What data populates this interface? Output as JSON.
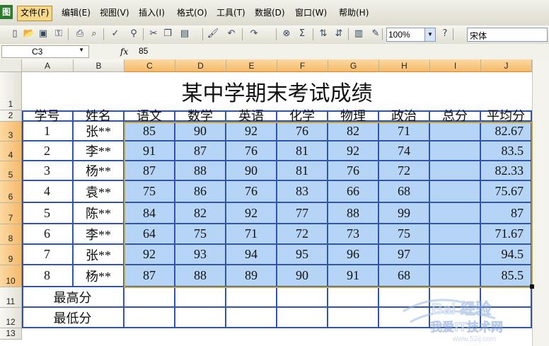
{
  "app": {
    "icon": "excel-app-icon"
  },
  "menu": [
    {
      "label": "文件(F)",
      "active": true
    },
    {
      "label": "编辑(E)"
    },
    {
      "label": "视图(V)"
    },
    {
      "label": "插入(I)"
    },
    {
      "label": "格式(O)"
    },
    {
      "label": "工具(T)"
    },
    {
      "label": "数据(D)"
    },
    {
      "label": "窗口(W)"
    },
    {
      "label": "帮助(H)"
    }
  ],
  "toolbar": {
    "zoom": "100%",
    "font": "宋体",
    "icons": [
      "new-icon",
      "open-icon",
      "save-icon",
      "permission-icon",
      "print-icon",
      "print-preview-icon",
      "spelling-icon",
      "research-icon",
      "cut-icon",
      "copy-icon",
      "paste-icon",
      "format-painter-icon",
      "undo-icon",
      "redo-icon",
      "hyperlink-icon",
      "autosum-icon",
      "sort-ascending-icon",
      "sort-descending-icon",
      "chart-wizard-icon",
      "drawing-icon",
      "help-icon"
    ]
  },
  "formula_bar": {
    "name_box": "C3",
    "fx": "fx",
    "value": "85"
  },
  "columns": [
    "A",
    "B",
    "C",
    "D",
    "E",
    "F",
    "G",
    "H",
    "I",
    "J"
  ],
  "rows": [
    "1",
    "2",
    "3",
    "4",
    "5",
    "6",
    "7",
    "8",
    "9",
    "10",
    "11",
    "12",
    "13"
  ],
  "sheet": {
    "title": "某中学期末考试成绩",
    "headers": [
      "学号",
      "姓名",
      "语文",
      "数学",
      "英语",
      "化学",
      "物理",
      "政治",
      "总分",
      "平均分"
    ],
    "data": [
      [
        "1",
        "张**",
        "85",
        "90",
        "92",
        "76",
        "82",
        "71",
        "",
        "82.67"
      ],
      [
        "2",
        "李**",
        "91",
        "87",
        "76",
        "81",
        "92",
        "74",
        "",
        "83.5"
      ],
      [
        "3",
        "杨**",
        "87",
        "88",
        "90",
        "81",
        "76",
        "72",
        "",
        "82.33"
      ],
      [
        "4",
        "袁**",
        "75",
        "86",
        "76",
        "83",
        "66",
        "68",
        "",
        "75.67"
      ],
      [
        "5",
        "陈**",
        "84",
        "82",
        "92",
        "77",
        "88",
        "99",
        "",
        "87"
      ],
      [
        "6",
        "李**",
        "64",
        "75",
        "71",
        "72",
        "73",
        "75",
        "",
        "71.67"
      ],
      [
        "7",
        "张**",
        "92",
        "93",
        "94",
        "95",
        "96",
        "97",
        "",
        "94.5"
      ],
      [
        "8",
        "杨**",
        "87",
        "88",
        "89",
        "90",
        "91",
        "68",
        "",
        "85.5"
      ]
    ],
    "summary": [
      "最高分",
      "最低分"
    ]
  },
  "watermark": {
    "brand": "Bai 经验",
    "text": "我爱IT技术网",
    "url": "www.52ij.com"
  }
}
